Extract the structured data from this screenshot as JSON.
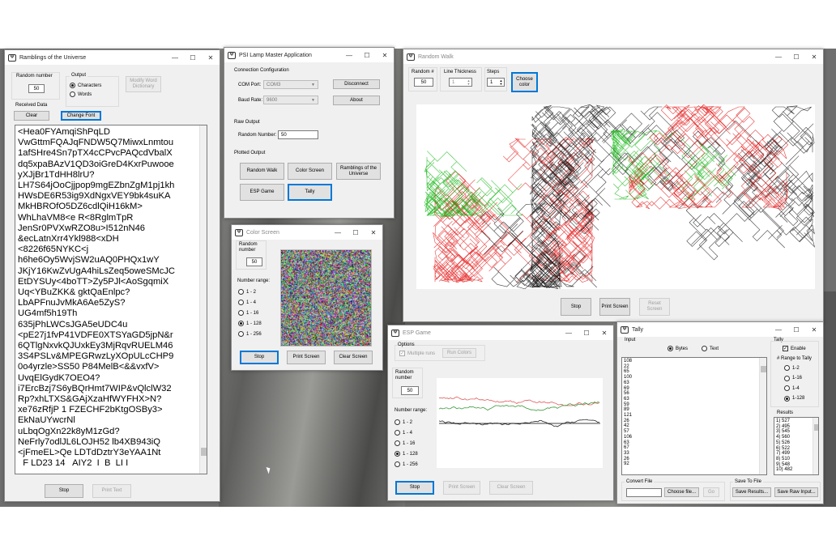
{
  "ramblings": {
    "title": "Ramblings of the Universe",
    "random_number_label": "Random number",
    "random_number_value": "50",
    "output_label": "Output",
    "output_options": [
      "Characters",
      "Words"
    ],
    "modify_button": "Modify Word Dictionary",
    "received_label": "Received Data",
    "clear_button": "Clear",
    "change_font_button": "Change Font",
    "text_lines": [
      "<Hea0FYAmqiShPqLD",
      "VwGttmFQAJqFNDW5Q7MiwxLnmtou",
      "1afSHre4Sn7pTX4cCPvcPAQcdVbalX",
      "dq5xpaBAzV1QD3oiGreD4KxrPuwooe",
      "yXJjBr1TdHH8lrU?",
      "LH7S64jOoCjjpop9mgEZbnZgM1pj1kh",
      "HWsDE6R53ig9XdNgxVEY9bk4suKA",
      "MkHBROfO5DZ6cdlQiH16kM>",
      "WhLhaVM8<e R<8RglmTpR",
      "JenSr0PVXwRZO8u>I512nN46",
      "&ecLatnXrr4Ykl988<xDH",
      "<8226f65NYKC<j",
      "h6he6Oy5WvjSW2uAQ0PHQx1wY",
      "JKjY16KwZvUgA4hiLsZeq5oweSMcJC",
      "EtDYSUy<4boTT>Zy5PJl<AoSgqmiX",
      "Uq<YBuZKK& gktQaEnlpc?",
      "LbAPFnuJvMkA6Ae5ZyS?",
      "UG4mf5h19Th",
      "635jPhLWCsJGA5eUDC4u",
      "<pE27j1fvP41VDFE0XTSYaGD5jpN&r",
      "6QTlgNxvkQJUxkEy3MjRqvRUELM46",
      "3S4PSLv&MPEGRwzLyXOpULcCHP9",
      "0o4yrzle>SS50 P84MelB<&&vxfV>",
      "UvqElGydK7OEO4?",
      "i7ErcBzj7S6yBQrHmt7WIP&vQlclW32",
      "Rp?xhLTXS&GAjXzaHfWYFHX>N?",
      "xe76zRfjP 1 FZECHF2bKtgOSBy3>",
      "EkNaUYwcrNl",
      "uLbqOgXn22k8yM1zGd?",
      "NeFrly7odlJL6LOJH52 lb4XB943iQ",
      "<jFmeEL>Qe LDTdDztrY3eYAA1Nt",
      "  F LD23 14   AIY2  I  B  LI I"
    ],
    "stop_button": "Stop",
    "print_text_button": "Print Text"
  },
  "psi": {
    "title": "PSI Lamp Master Application",
    "connection_label": "Connection Configuration",
    "com_port_label": "COM Port:",
    "com_port_value": "COM3",
    "disconnect_button": "Disconnect",
    "baud_rate_label": "Baud Rate:",
    "baud_rate_value": "9600",
    "about_button": "About",
    "raw_output_label": "Raw Output",
    "random_number_label": "Random Number:",
    "random_number_value": "50",
    "plotted_output_label": "Plotted Output",
    "random_walk_button": "Random Walk",
    "color_screen_button": "Color Screen",
    "ramblings_button": "Ramblings of the Universe",
    "esp_game_button": "ESP Game",
    "tally_button": "Tally"
  },
  "random_walk": {
    "title": "Random Walk",
    "random_label": "Random #",
    "random_value": "50",
    "thickness_label": "Line Thickness",
    "thickness_value": "1",
    "steps_label": "Steps",
    "steps_value": "1",
    "choose_color_button": "Choose color",
    "stop_button": "Stop",
    "print_screen_button": "Print Screen",
    "reset_screen_button": "Reset Screen",
    "colors": [
      "#e00000",
      "#00b000",
      "#000000"
    ]
  },
  "color_screen": {
    "title": "Color Screen",
    "random_label": "Random number",
    "random_value": "50",
    "range_label": "Number range:",
    "ranges": [
      "1 - 2",
      "1 - 4",
      "1 - 16",
      "1 - 128",
      "1 - 256"
    ],
    "selected_range": "1 - 128",
    "stop_button": "Stop",
    "print_screen_button": "Print Screen",
    "clear_screen_button": "Clear Screen"
  },
  "esp": {
    "title": "ESP Game",
    "options_label": "Options",
    "multiple_runs_label": "Multiple runs",
    "run_colors_button": "Run Colors",
    "random_label": "Random number",
    "random_value": "50",
    "range_label": "Number range:",
    "ranges": [
      "1 - 2",
      "1 - 4",
      "1 - 16",
      "1 - 128",
      "1 - 256"
    ],
    "selected_range": "1 - 128",
    "stop_button": "Stop",
    "print_screen_button": "Print Screen",
    "clear_screen_button": "Clear Screen",
    "colors": [
      "#e05a5a",
      "#3a9a3a",
      "#222222"
    ]
  },
  "tally": {
    "title": "Tally",
    "input_label": "Input",
    "bytes_label": "Bytes",
    "text_label": "Text",
    "input_values": [
      "108",
      "22",
      "65",
      "100",
      "63",
      "69",
      "56",
      "63",
      "59",
      "89",
      "121",
      "26",
      "42",
      "57",
      "106",
      "63",
      "67",
      "33",
      "26",
      "92"
    ],
    "tally_label": "Tally",
    "enable_label": "Enable",
    "range_label": "# Range to Tally",
    "ranges": [
      "1-2",
      "1-16",
      "1-4",
      "1-128"
    ],
    "selected_range": "1-128",
    "results_label": "Results",
    "results": [
      "1) 527",
      "2) 495",
      "3) 545",
      "4) 560",
      "5) 526",
      "6) 522",
      "7) 499",
      "8) 510",
      "9) 548",
      "10) 482"
    ],
    "convert_file_label": "Convert File",
    "choose_file_button": "Choose file...",
    "go_button": "Go",
    "save_label": "Save To File",
    "save_results_button": "Save Results...",
    "save_raw_button": "Save Raw Input..."
  }
}
